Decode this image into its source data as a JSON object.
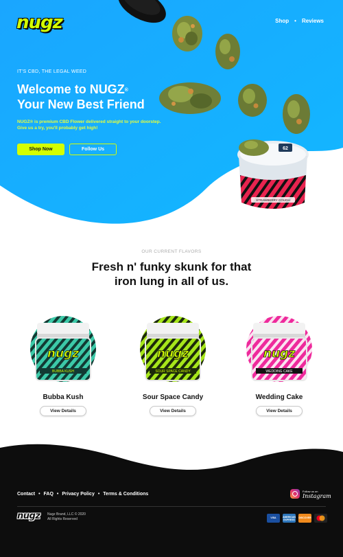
{
  "brand": {
    "logo_text": "nugz"
  },
  "nav": {
    "items": [
      "Shop",
      "Reviews"
    ],
    "separator": "•"
  },
  "hero": {
    "eyebrow": "IT'S CBD, THE LEGAL WEED",
    "headline_line1": "Welcome to NUGZ",
    "headline_mark": "®",
    "headline_line2": "Your New Best Friend",
    "subtext": "NUGZ® is premium CBD Flower delivered straight to your doorstep. Give us a try, you'll probably get high!",
    "primary_button": "Shop Now",
    "secondary_button": "Follow Us",
    "jar_lid_number": "62",
    "jar_label_text": "STRAWBERRY COUGH",
    "bg_color": "#1aa9ff",
    "accent_color": "#d4ff00"
  },
  "flavors": {
    "eyebrow": "OUR CURRENT FLAVORS",
    "title_line1": "Fresh n' funky skunk for that",
    "title_line2": "iron lung in all of us.",
    "view_label": "View Details",
    "products": [
      {
        "name": "Bubba Kush",
        "jar_label": "BUBBA KUSH",
        "color": "#3cc9a8",
        "lid": "#ffffff"
      },
      {
        "name": "Sour Space Candy",
        "jar_label": "SOUR SPACE CANDY",
        "color": "#a6e61a",
        "lid": "#ffffff"
      },
      {
        "name": "Wedding Cake",
        "jar_label": "WEDDING CAKE",
        "color": "#ee2a9c",
        "lid": "#ffffff"
      }
    ]
  },
  "footer": {
    "links": [
      "Contact",
      "FAQ",
      "Privacy Policy",
      "Terms & Conditions"
    ],
    "separator": "•",
    "instagram_small": "Follow us on",
    "instagram_big": "Instagram",
    "copyright_line1": "Nugz Brand, LLC © 2020",
    "copyright_line2": "All Rights Reserved",
    "payment_cards": [
      "VISA",
      "AMERICAN EXPRESS",
      "DISCOVER",
      "mastercard"
    ]
  }
}
